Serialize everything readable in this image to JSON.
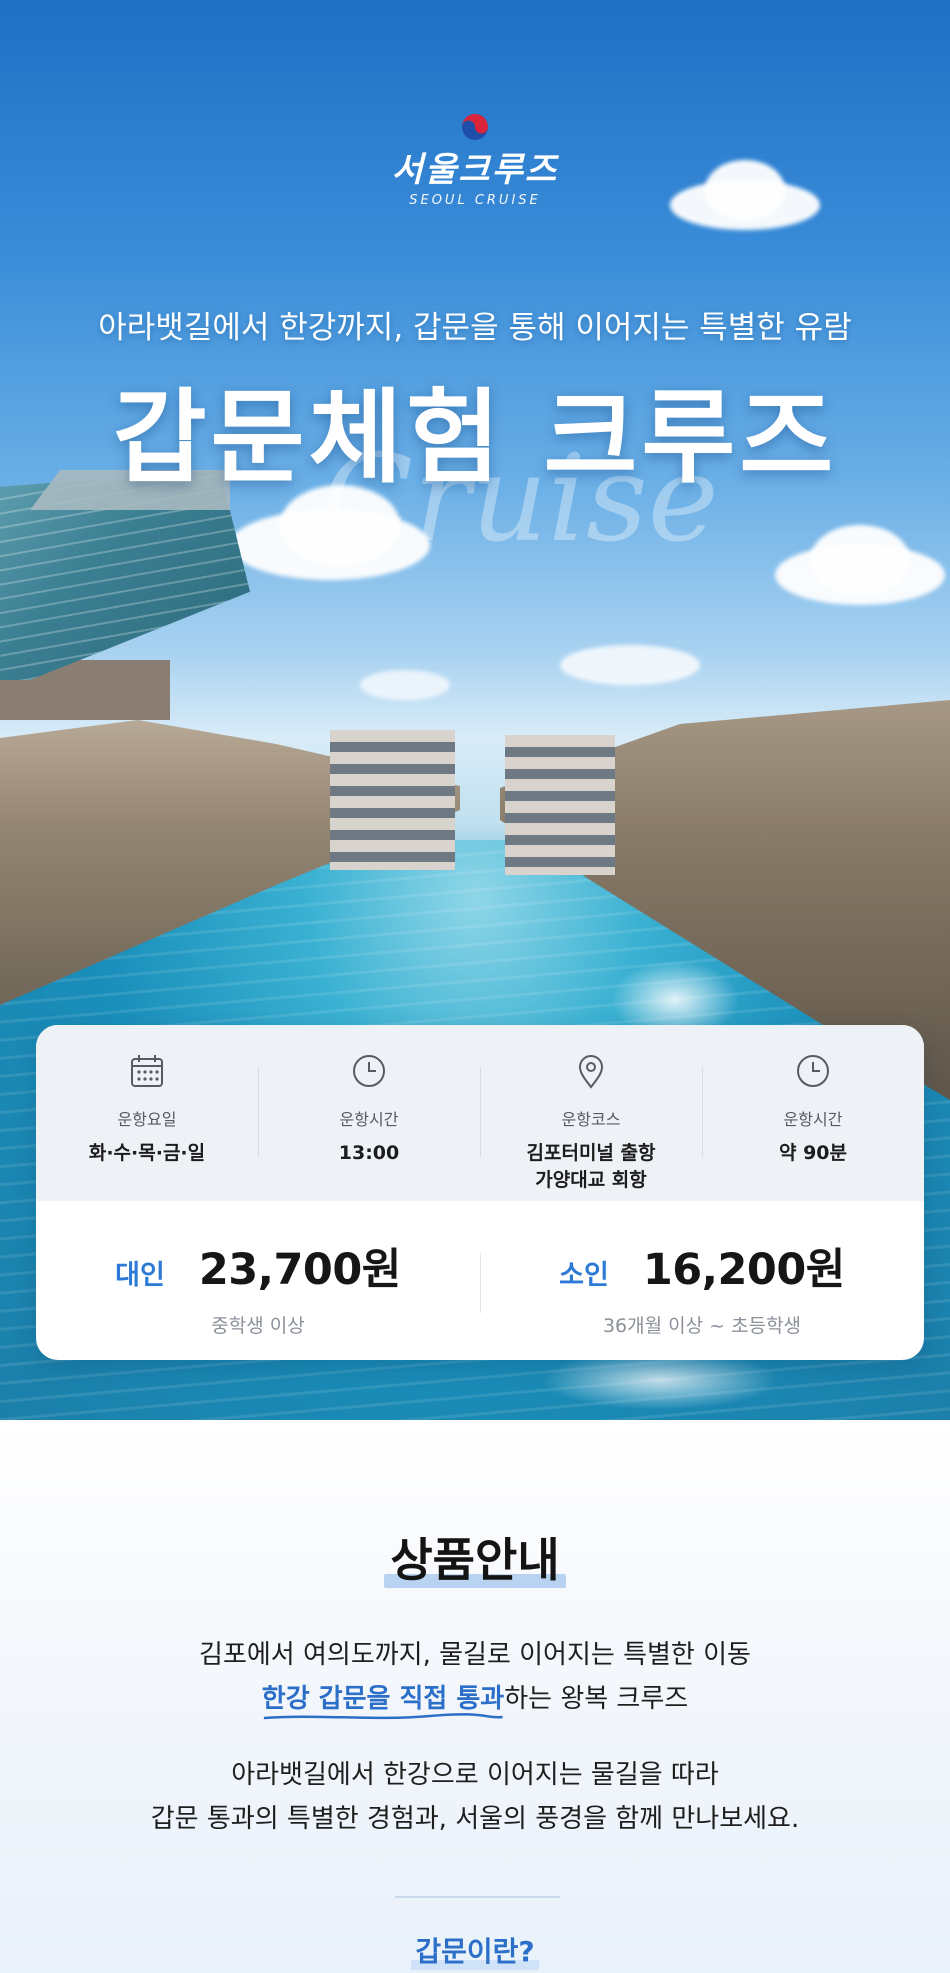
{
  "brand": {
    "name_ko": "서울크루즈",
    "name_en": "SEOUL CRUISE"
  },
  "hero": {
    "subtitle": "아라뱃길에서 한강까지, 갑문을 통해 이어지는 특별한 유람",
    "title": "갑문체험 크루즈",
    "script_word": "Cruise"
  },
  "info": {
    "items": [
      {
        "icon": "calendar-icon",
        "label": "운항요일",
        "value": "화·수·목·금·일"
      },
      {
        "icon": "clock-icon",
        "label": "운항시간",
        "value": "13:00"
      },
      {
        "icon": "location-pin-icon",
        "label": "운항코스",
        "value_line1": "김포터미널 출항",
        "value_line2": "가양대교 회항"
      },
      {
        "icon": "clock-icon",
        "label": "운항시간",
        "value": "약 90분"
      }
    ]
  },
  "prices": {
    "adult": {
      "type": "대인",
      "amount": "23,700원",
      "note": "중학생 이상"
    },
    "child": {
      "type": "소인",
      "amount": "16,200원",
      "note": "36개월 이상 ~ 초등학생"
    }
  },
  "product": {
    "title": "상품안내",
    "line1": "김포에서 여의도까지, 물길로 이어지는 특별한 이동",
    "line2_highlight": "한강 갑문을 직접 통과",
    "line2_rest": "하는 왕복 크루즈",
    "line3": "아라뱃길에서 한강으로 이어지는 물길을 따라",
    "line4": "갑문 통과의 특별한 경험과, 서울의 풍경을 함께 만나보세요.",
    "next_title": "갑문이란?"
  },
  "colors": {
    "accent_blue": "#2c7ad6",
    "highlight_blue": "#2c6fc9",
    "title_highlight": "#b8d3f2"
  }
}
